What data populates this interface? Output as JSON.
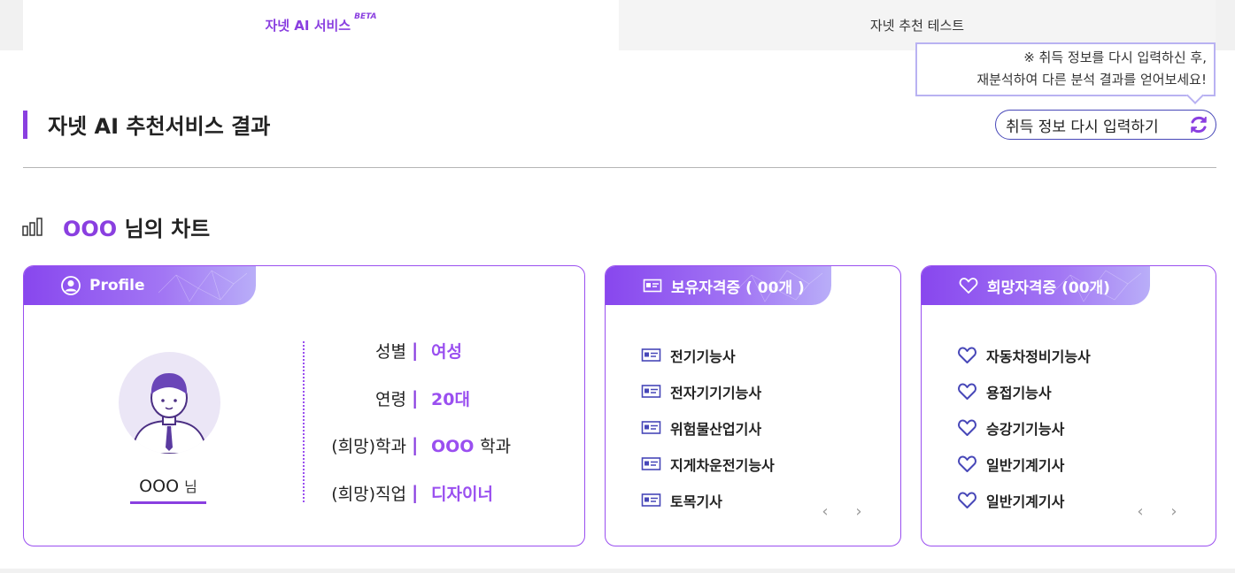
{
  "tabs": {
    "active_label": "자넷 AI 서비스",
    "active_badge": "BETA",
    "inactive_label": "자넷 추천 테스트"
  },
  "header": {
    "title": "자넷 AI 추천서비스 결과",
    "tooltip_line1": "※ 취득 정보를 다시 입력하신 후,",
    "tooltip_line2": "재분석하여 다른 분석 결과를 얻어보세요!",
    "reenter_button": "취득 정보 다시 입력하기"
  },
  "chart_section": {
    "user_name": "OOO",
    "title_suffix": "님의 차트"
  },
  "profile": {
    "heading": "Profile",
    "name": "OOO",
    "honorific": "님",
    "rows": [
      {
        "label": "성별",
        "value": "여성",
        "suffix": ""
      },
      {
        "label": "연령",
        "value": "20대",
        "suffix": ""
      },
      {
        "label": "(희망)학과",
        "value": "OOO",
        "suffix": "학과"
      },
      {
        "label": "(희망)직업",
        "value": "디자이너",
        "suffix": ""
      }
    ],
    "separator": "|"
  },
  "owned_certs": {
    "heading": "보유자격증 ( 00개 )",
    "items": [
      "전기기능사",
      "전자기기기능사",
      "위험물산업기사",
      "지게차운전기능사",
      "토목기사"
    ],
    "prev": "‹",
    "next": "›"
  },
  "wish_certs": {
    "heading": "희망자격증 (00개)",
    "items": [
      "자동차정비기능사",
      "용접기능사",
      "승강기기능사",
      "일반기계기사",
      "일반기계기사"
    ],
    "prev": "‹",
    "next": "›"
  },
  "colors": {
    "accent": "#8a3fe0",
    "border": "#9a4ff0",
    "button_border": "#4747b8"
  }
}
